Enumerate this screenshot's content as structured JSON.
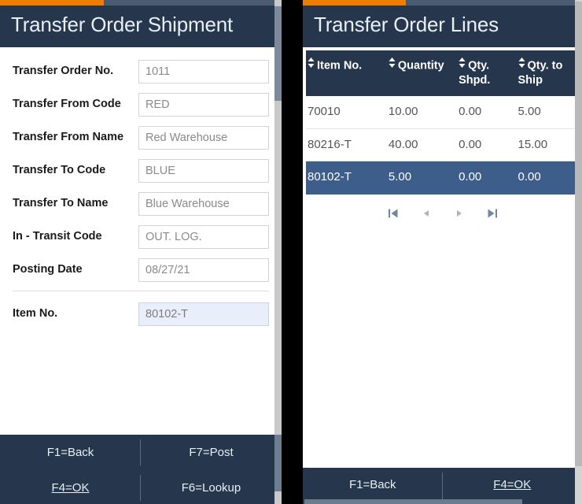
{
  "colors": {
    "accent_orange": "#ef7d00",
    "header_navy": "#26374d",
    "selected_row_blue": "#3d5d8a",
    "highlight_field": "#e8eefa",
    "progress_track": "#4a5b72"
  },
  "left_panel": {
    "title": "Transfer Order Shipment",
    "progress_percent": 37,
    "fields": [
      {
        "label": "Transfer Order No.",
        "value": "1011",
        "highlighted": false
      },
      {
        "label": "Transfer From Code",
        "value": "RED",
        "highlighted": false
      },
      {
        "label": "Transfer From Name",
        "value": "Red Warehouse",
        "highlighted": false
      },
      {
        "label": "Transfer To Code",
        "value": "BLUE",
        "highlighted": false
      },
      {
        "label": "Transfer To Name",
        "value": "Blue Warehouse",
        "highlighted": false
      },
      {
        "label": "In - Transit Code",
        "value": "OUT. LOG.",
        "highlighted": false
      },
      {
        "label": "Posting Date",
        "value": "08/27/21",
        "highlighted": false
      }
    ],
    "item_field": {
      "label": "Item No.",
      "value": "80102-T",
      "highlighted": true
    },
    "footer_keys": [
      {
        "label": "F1=Back",
        "focused": false
      },
      {
        "label": "F7=Post",
        "focused": false
      },
      {
        "label": "F4=OK",
        "focused": true
      },
      {
        "label": "F6=Lookup",
        "focused": false
      }
    ]
  },
  "right_panel": {
    "title": "Transfer Order Lines",
    "progress_percent": 37,
    "table": {
      "columns": [
        {
          "label": "Item No.",
          "sortable": true
        },
        {
          "label": "Quantity",
          "sortable": true
        },
        {
          "label": "Qty. Shpd.",
          "sortable": true
        },
        {
          "label": "Qty. to Ship",
          "sortable": true
        }
      ],
      "rows": [
        {
          "item_no": "70010",
          "quantity": "10.00",
          "qty_shpd": "0.00",
          "qty_to_ship": "5.00",
          "selected": false
        },
        {
          "item_no": "80216-T",
          "quantity": "40.00",
          "qty_shpd": "0.00",
          "qty_to_ship": "15.00",
          "selected": false
        },
        {
          "item_no": "80102-T",
          "quantity": "5.00",
          "qty_shpd": "0.00",
          "qty_to_ship": "0.00",
          "selected": true
        }
      ]
    },
    "pagination": [
      {
        "name": "first-page",
        "glyph": "first"
      },
      {
        "name": "prev-page",
        "glyph": "prev"
      },
      {
        "name": "next-page",
        "glyph": "next"
      },
      {
        "name": "last-page",
        "glyph": "last"
      }
    ],
    "footer_keys": [
      {
        "label": "F1=Back",
        "focused": false
      },
      {
        "label": "F4=OK",
        "focused": true
      }
    ]
  }
}
